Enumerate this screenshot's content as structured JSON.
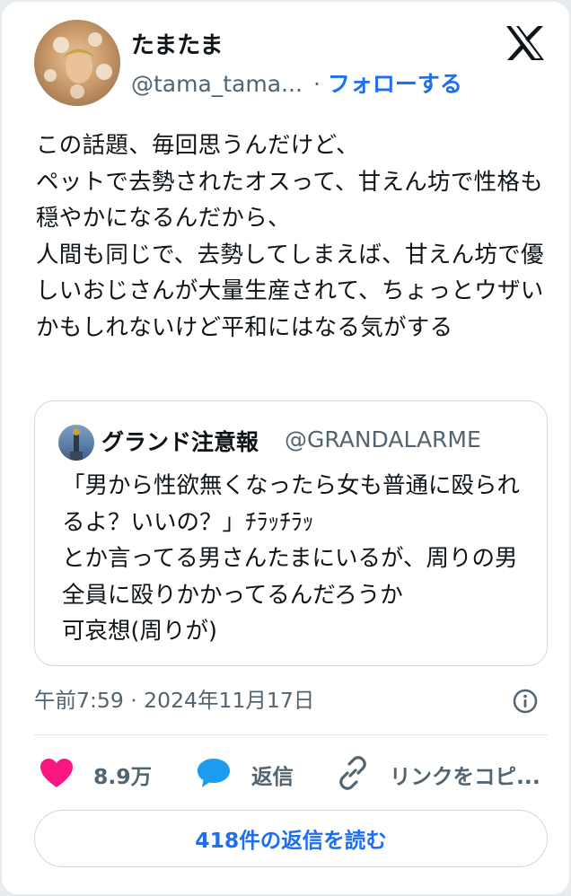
{
  "author": {
    "display_name": "たまたま",
    "handle": "@tama_tama...",
    "separator": "·",
    "follow_label": "フォローする"
  },
  "tweet": {
    "text": "この話題、毎回思うんだけど、\nペットで去勢されたオスって、甘えん坊で性格も穏やかになるんだから、\n人間も同じで、去勢してしまえば、甘えん坊で優しいおじさんが大量生産されて、ちょっとウザいかもしれないけど平和にはなる気がする",
    "timestamp": "午前7:59 · 2024年11月17日"
  },
  "quoted_tweet": {
    "display_name": "グランド注意報",
    "handle": "@GRANDALARME",
    "text": "「男から性欲無くなったら女も普通に殴られるよ？いいの？」ﾁﾗｯﾁﾗｯ\nとか言ってる男さんたまにいるが、周りの男全員に殴りかかってるんだろうか\n可哀想(周りが)"
  },
  "actions": {
    "likes_count": "8.9万",
    "reply_label": "返信",
    "copy_link_label": "リンクをコピ..."
  },
  "read_replies_label": "418件の返信を読む",
  "icons": {
    "logo": "x-logo-icon",
    "info": "info-icon",
    "like": "heart-icon",
    "reply": "speech-bubble-icon",
    "copy_link": "link-icon"
  },
  "colors": {
    "link_blue": "#1d6ff0",
    "like_pink": "#f91880",
    "reply_blue": "#1d9bf0",
    "secondary_text": "#536471"
  }
}
